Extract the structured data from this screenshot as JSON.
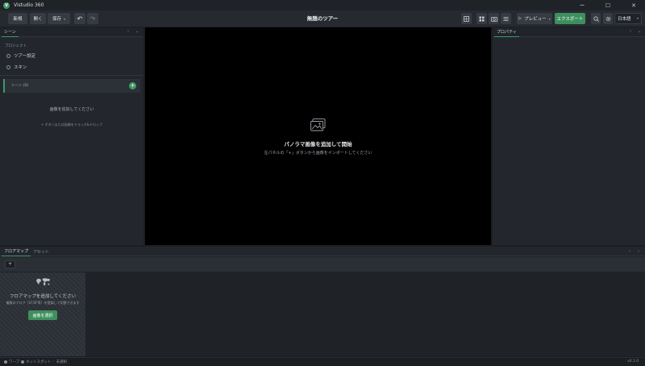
{
  "window": {
    "app_name": "Vistudio 360",
    "minimize": "─",
    "maximize": "☐",
    "close": "✕"
  },
  "toolbar": {
    "new_label": "新規",
    "open_label": "開く",
    "save_label": "保存",
    "undo_icon": "↶",
    "redo_icon": "↷",
    "tour_title": "無題のツアー",
    "preview_label": "プレビュー",
    "export_label": "エクスポート",
    "language": "日本語"
  },
  "left_panel": {
    "tab_label": "シーン",
    "project_section": "プロジェクト",
    "items": [
      "ツアー設定",
      "スキン"
    ],
    "scenes_header": "シーン (0)",
    "empty_title": "画像を追加してください",
    "empty_hint": "+ ボタンまたは画像をドラッグ&ドロップ"
  },
  "viewer": {
    "title": "パノラマ画像を追加して開始",
    "subtitle": "左パネルの「+」ボタンから画像をインポートしてください"
  },
  "right_panel": {
    "tab_label": "プロパティ"
  },
  "bottom": {
    "tabs": [
      "フロアマップ",
      "アセット"
    ],
    "add_label": "+",
    "floorplan_title": "フロアマップを追加してください",
    "floorplan_hint": "複数のフロア（1F/2F等）を登録して切替できます",
    "select_image_button": "画像を選択"
  },
  "statusbar": {
    "item1": "ワープ",
    "item2": "ホットスポット",
    "item3": "未選択",
    "version": "v0.1.0"
  },
  "colors": {
    "accent": "#3e9a66",
    "background": "#1b1e23",
    "panel": "#23272d",
    "viewer": "#000000"
  }
}
